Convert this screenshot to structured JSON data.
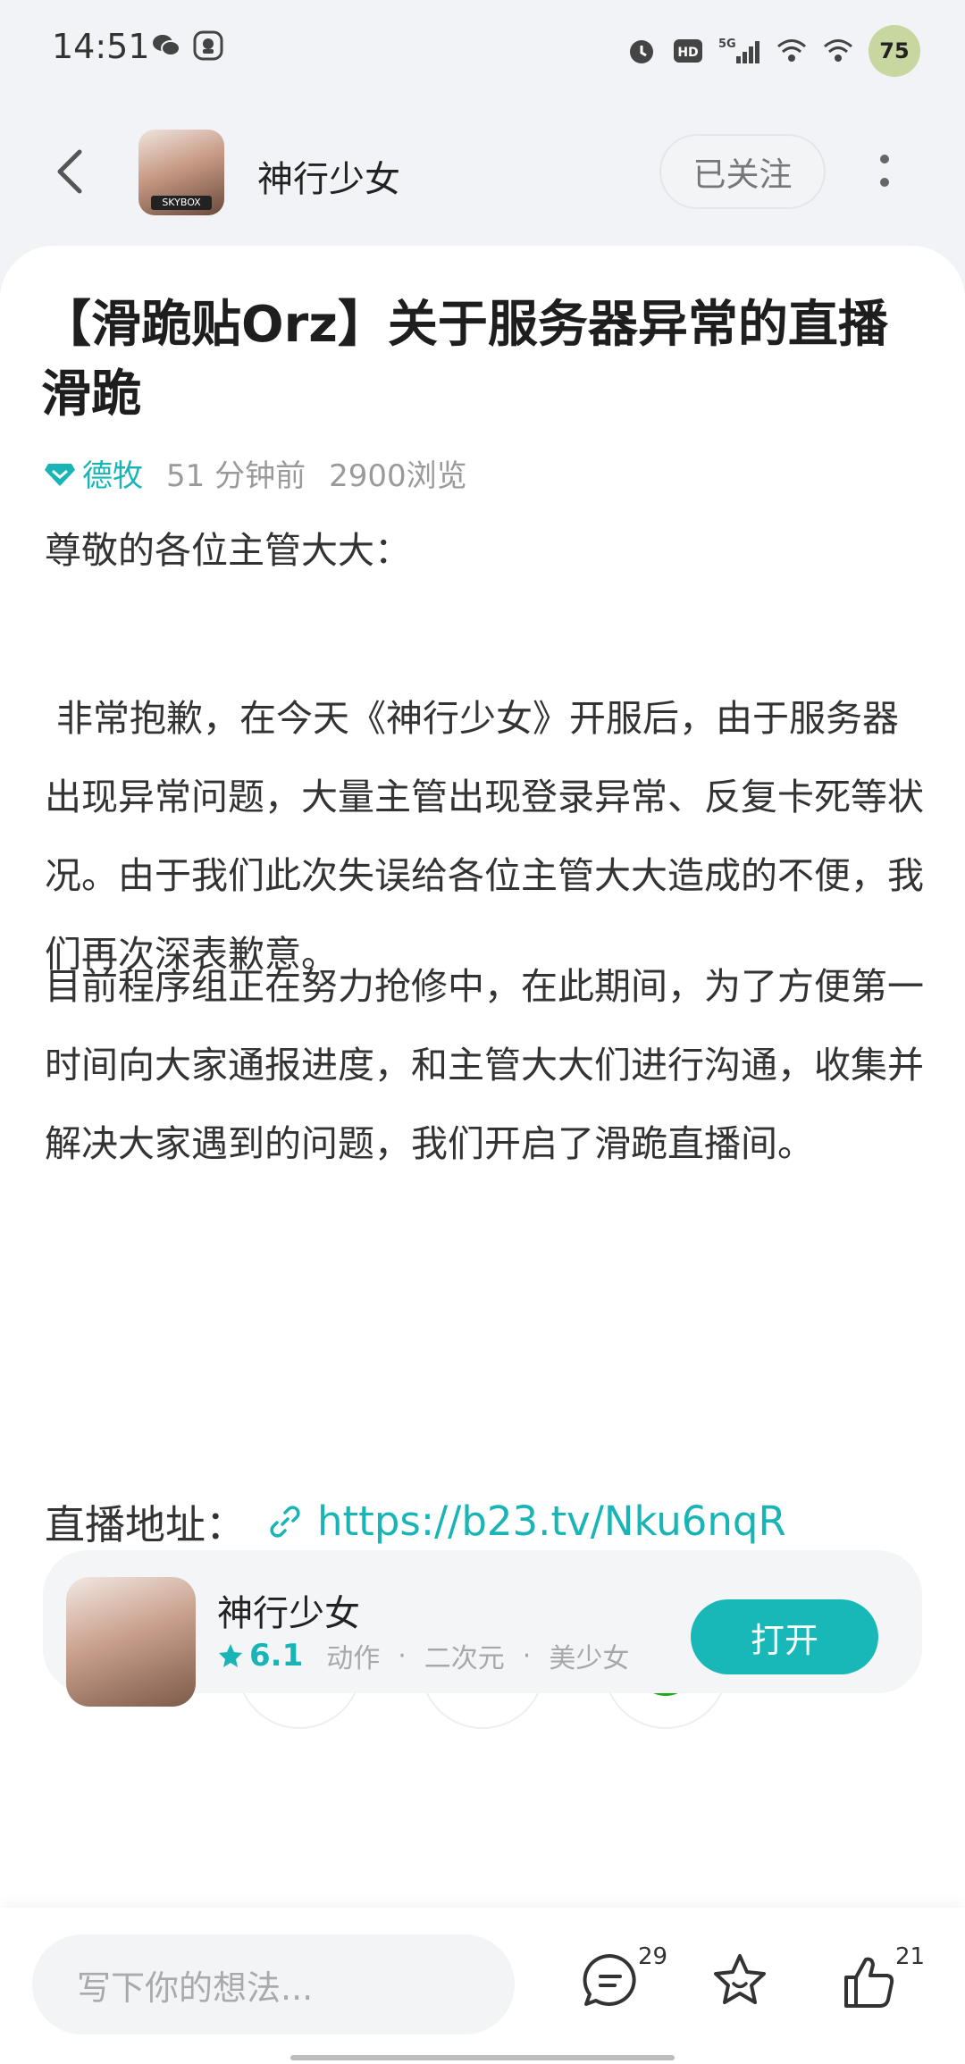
{
  "status_bar": {
    "time": "14:51",
    "battery": "75",
    "icons": [
      "wechat-icon",
      "app-icon",
      "alarm-icon",
      "hd-icon",
      "5g-signal-icon",
      "wifi-plus-icon",
      "wifi-icon"
    ]
  },
  "header": {
    "channel_name": "神行少女",
    "avatar_tag": "SKYBOX",
    "follow_label": "已关注"
  },
  "post": {
    "title": "【滑跪贴Orz】关于服务器异常的直播滑跪",
    "author": "德牧",
    "time_ago": "51 分钟前",
    "views": "2900浏览",
    "paragraphs": [
      "尊敬的各位主管大大：",
      " 非常抱歉，在今天《神行少女》开服后，由于服务器出现异常问题，大量主管出现登录异常、反复卡死等状况。由于我们此次失误给各位主管大大造成的不便，我们再次深表歉意。",
      "目前程序组正在努力抢修中，在此期间，为了方便第一时间向大家通报进度，和主管大大们进行沟通，收集并解决大家遇到的问题，我们开启了滑跪直播间。"
    ],
    "link_label": "直播地址：",
    "link_url": "https://b23.tv/Nku6nqR"
  },
  "actions": {
    "like_count": "21"
  },
  "game_card": {
    "name": "神行少女",
    "rating": "6.1",
    "tags": [
      "动作",
      "二次元",
      "美少女"
    ],
    "open_label": "打开"
  },
  "bottom_bar": {
    "input_placeholder": "写下你的想法...",
    "comment_count": "29",
    "like_count": "21"
  },
  "colors": {
    "accent": "#19b5b6",
    "wechat_green": "#1aad19"
  }
}
